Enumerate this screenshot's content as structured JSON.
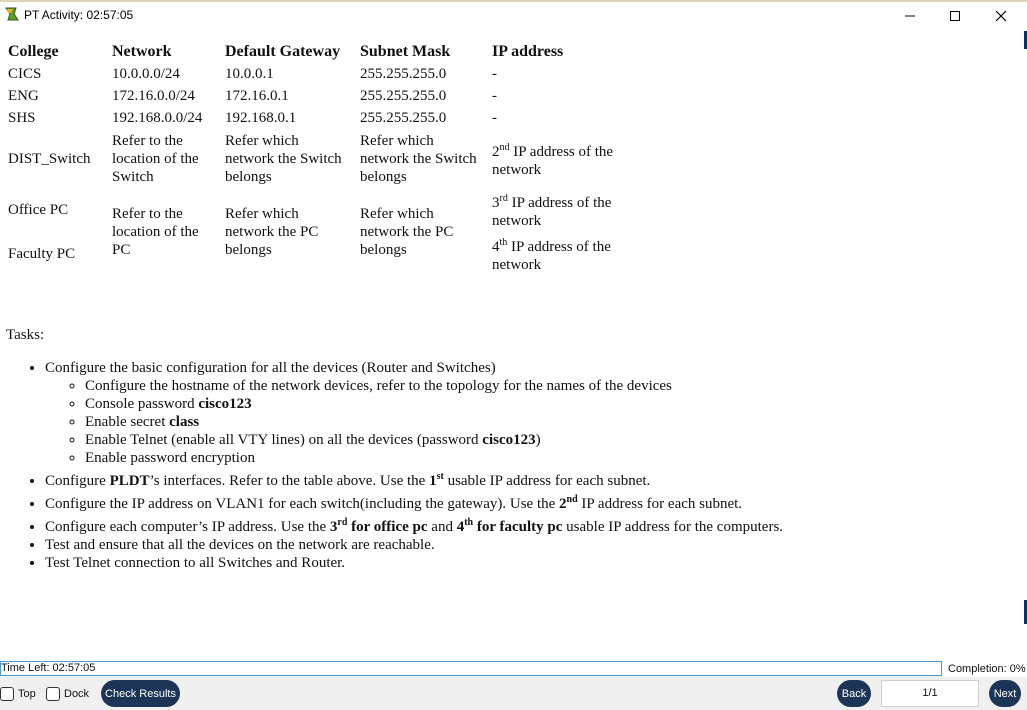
{
  "window": {
    "title": "PT Activity: 02:57:05"
  },
  "table": {
    "headers": [
      "College",
      "Network",
      "Default Gateway",
      "Subnet Mask",
      "IP address"
    ],
    "rows": [
      {
        "college": "CICS",
        "network": "10.0.0.0/24",
        "gateway": "10.0.0.1",
        "mask": "255.255.255.0",
        "ip": "-"
      },
      {
        "college": "ENG",
        "network": "172.16.0.0/24",
        "gateway": "172.16.0.1",
        "mask": "255.255.255.0",
        "ip": "-"
      },
      {
        "college": "SHS",
        "network": "192.168.0.0/24",
        "gateway": "192.168.0.1",
        "mask": "255.255.255.0",
        "ip": "-"
      }
    ],
    "dist_switch": {
      "label": "DIST_Switch",
      "network_lines": [
        "Refer to the",
        "location of the",
        "Switch"
      ],
      "gateway_lines": [
        "Refer which",
        "network the Switch",
        "belongs"
      ],
      "mask_lines": [
        "Refer which",
        "network the Switch",
        "belongs"
      ],
      "ip_sup": "nd",
      "ip_num": "2",
      "ip_line1": " IP address of the",
      "ip_line2": "network"
    },
    "office_pc": {
      "label": "Office PC",
      "ip_num": "3",
      "ip_sup": "rd",
      "ip_line1": " IP address of the",
      "ip_line2": "network"
    },
    "faculty_pc": {
      "label": "Faculty PC",
      "ip_num": "4",
      "ip_sup": "th",
      "ip_line1": " IP address of the",
      "ip_line2": "network"
    },
    "pc_shared": {
      "network_lines": [
        "Refer to the",
        "location of the",
        "PC"
      ],
      "gateway_lines": [
        "Refer which",
        "network the PC",
        "belongs"
      ],
      "mask_lines": [
        "Refer which",
        "network the PC",
        "belongs"
      ]
    }
  },
  "tasks": {
    "label": "Tasks:",
    "t1": "Configure the basic configuration for all the devices (Router and Switches)",
    "t1_sub": {
      "hostname": "Configure the hostname of the network devices, refer to the topology for the names of the devices",
      "console_prefix": "Console password ",
      "console_bold": "cisco123",
      "secret_prefix": "Enable secret ",
      "secret_bold": "class",
      "telnet_prefix": "Enable Telnet (enable all VTY lines) on all the devices (password ",
      "telnet_bold": "cisco123",
      "telnet_suffix": ")",
      "encryption": "Enable password encryption"
    },
    "t2": {
      "a": "Configure ",
      "b": "PLDT",
      "c": "’s interfaces. Refer to the table above. Use the ",
      "d": "1",
      "e": "st",
      "f": " usable IP address for each subnet."
    },
    "t3": {
      "a": "Configure the IP address on VLAN1 for each switch(including the gateway). Use the ",
      "b": "2",
      "c": "nd",
      "d": " IP address for each subnet."
    },
    "t4": {
      "a": "Configure each computer’s IP address. Use the ",
      "b": "3",
      "c": "rd",
      "d": " for office pc",
      "e": " and ",
      "f": "4",
      "g": "th",
      "h": " for faculty pc",
      "i": " usable IP address for the computers."
    },
    "t5": "Test and ensure that all the devices on the network are reachable.",
    "t6": "Test Telnet connection to all Switches and Router."
  },
  "status": {
    "time_left": "Time Left: 02:57:05",
    "completion": "Completion: 0%"
  },
  "footer": {
    "top_label": "Top",
    "dock_label": "Dock",
    "check_results": "Check Results",
    "back": "Back",
    "page": "1/1",
    "next": "Next"
  },
  "colors": {
    "button_bg": "#1c3557",
    "timebar_border": "#4f9ad4"
  }
}
